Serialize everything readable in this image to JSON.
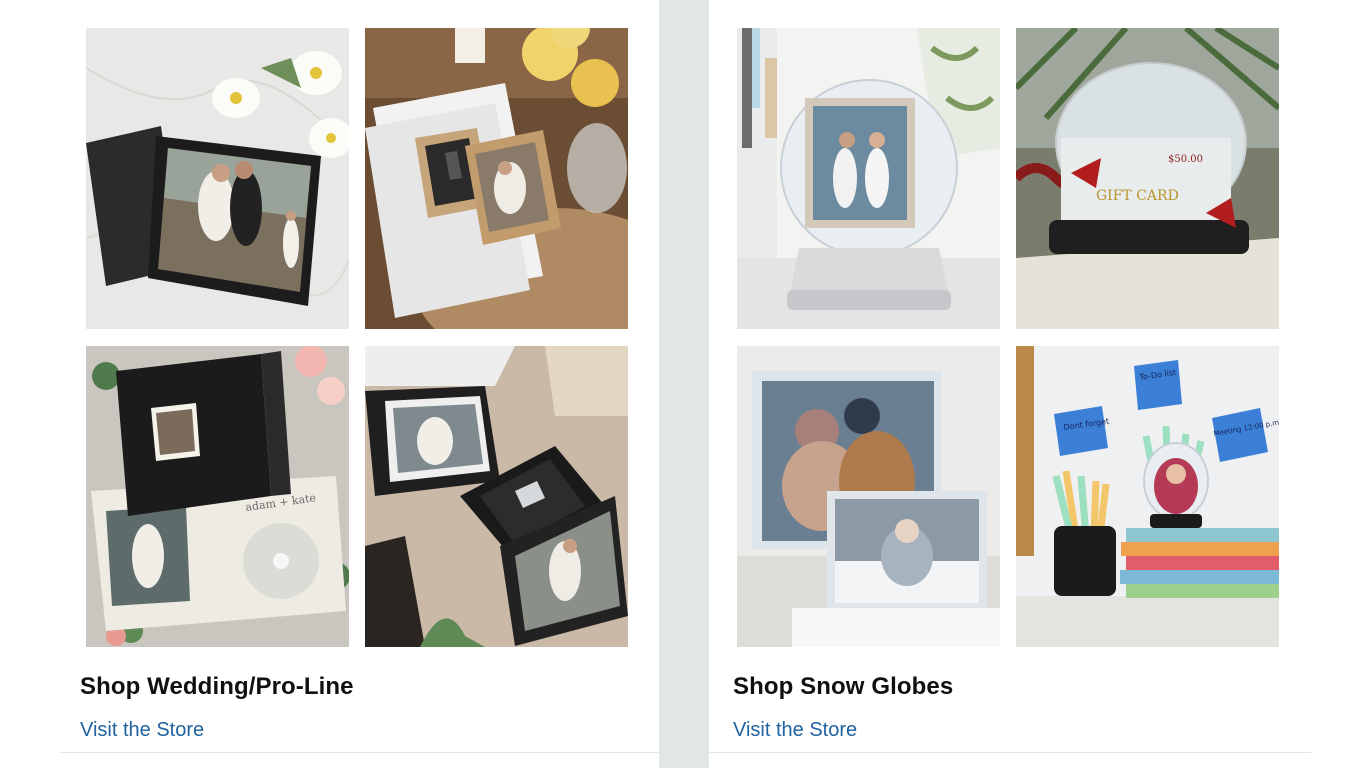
{
  "cards": [
    {
      "title": "Shop Wedding/Pro-Line",
      "link": "Visit the Store",
      "images": [
        {
          "alt": "Black photo case with wedding photo"
        },
        {
          "alt": "Wooden USB box with wedding photo"
        },
        {
          "alt": "Black wedding album folio with CD"
        },
        {
          "alt": "Black photo boxes with USB drive"
        }
      ]
    },
    {
      "title": "Shop Snow Globes",
      "link": "Visit the Store",
      "images": [
        {
          "alt": "Photo snow globe"
        },
        {
          "alt": "Gift card snow globe",
          "text": "GIFT CARD",
          "price": "$50.00"
        },
        {
          "alt": "Snow globe photo frames"
        },
        {
          "alt": "Photo snow globe pen holder",
          "notes": [
            "Dont forget",
            "To-Do list",
            "Meeting 12:00 p.m."
          ]
        }
      ]
    }
  ]
}
